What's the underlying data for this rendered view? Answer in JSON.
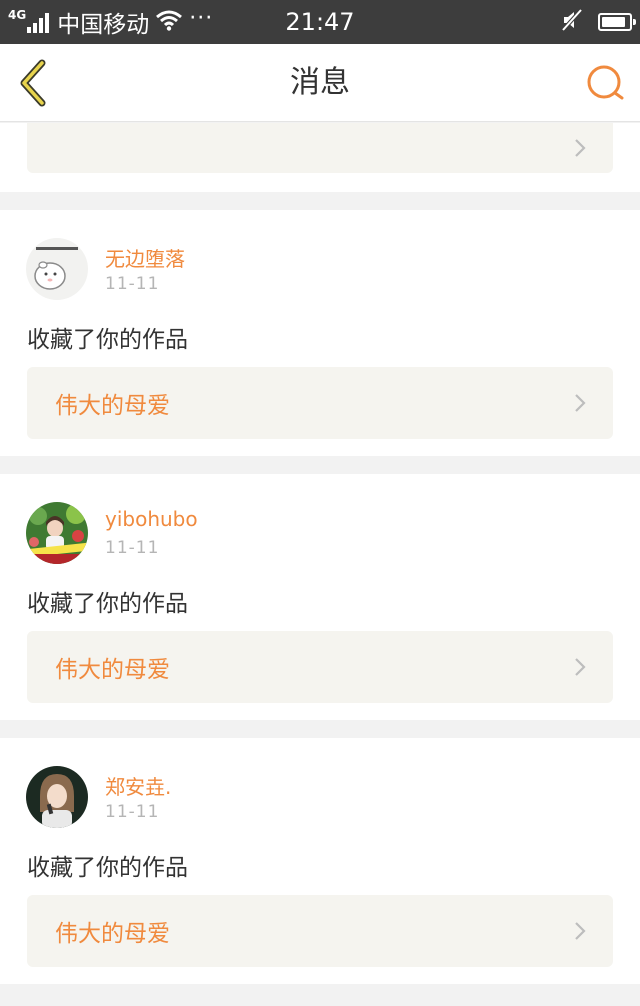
{
  "status_bar": {
    "network": "4G",
    "carrier": "中国移动",
    "more": "···",
    "time": "21:47",
    "battery_level": 0.9
  },
  "nav": {
    "title": "消息",
    "back_icon": "chevron-left-icon",
    "search_icon": "search-icon",
    "accent": "#f08a3e"
  },
  "partial_card": {
    "work_title": ""
  },
  "messages": [
    {
      "user": "无边堕落",
      "date": "11-11",
      "action": "收藏了你的作品",
      "work": "伟大的母爱",
      "avatar": "hamster-sticker-avatar"
    },
    {
      "user": "yibohubo",
      "date": "11-11",
      "action": "收藏了你的作品",
      "work": "伟大的母爱",
      "avatar": "photo-avatar-garden"
    },
    {
      "user": "郑安垚.",
      "date": "11-11",
      "action": "收藏了你的作品",
      "work": "伟大的母爱",
      "avatar": "photo-avatar-portrait"
    }
  ],
  "colors": {
    "status_bar_bg": "#3d3d3d",
    "accent": "#f08a3e",
    "work_box_bg": "#f5f4ef",
    "date_text": "#b5b5b5"
  }
}
